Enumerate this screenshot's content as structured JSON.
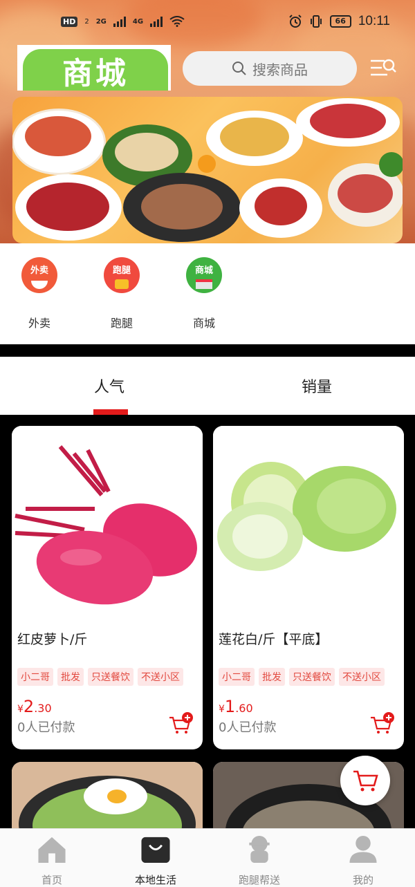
{
  "status_bar": {
    "hd": "HD",
    "sim": "2",
    "net1": "2G",
    "net2": "4G",
    "battery": "66",
    "time": "10:11"
  },
  "header": {
    "logo_text": "商城",
    "search_placeholder": "搜索商品",
    "menu_icon": "list-search-icon"
  },
  "categories": [
    {
      "label": "外卖",
      "badge": "外卖",
      "color": "#f15a3a"
    },
    {
      "label": "跑腿",
      "badge": "跑腿",
      "color": "#f04a3e"
    },
    {
      "label": "商城",
      "badge": "商城",
      "color": "#3fb241"
    }
  ],
  "tabs": [
    {
      "label": "人气",
      "active": true
    },
    {
      "label": "销量",
      "active": false
    }
  ],
  "products": [
    {
      "title": "红皮萝卜/斤",
      "tags": [
        "小二哥",
        "批发",
        "只送餐饮",
        "不送小区"
      ],
      "currency": "¥",
      "price_int": "2",
      "price_dec": ".30",
      "paid": "0人已付款"
    },
    {
      "title": "莲花白/斤【平底】",
      "tags": [
        "小二哥",
        "批发",
        "只送餐饮",
        "不送小区"
      ],
      "currency": "¥",
      "price_int": "1",
      "price_dec": ".60",
      "paid": "0人已付款"
    }
  ],
  "bottom_nav": [
    {
      "label": "首页",
      "icon": "home-icon",
      "active": false
    },
    {
      "label": "本地生活",
      "icon": "shopping-bag-icon",
      "active": true
    },
    {
      "label": "跑腿帮送",
      "icon": "courier-icon",
      "active": false
    },
    {
      "label": "我的",
      "icon": "user-icon",
      "active": false
    }
  ],
  "colors": {
    "accent": "#e31b1b",
    "tag_bg": "#fde7e7",
    "tag_text": "#e2493f",
    "logo_green": "#7fd14a"
  }
}
